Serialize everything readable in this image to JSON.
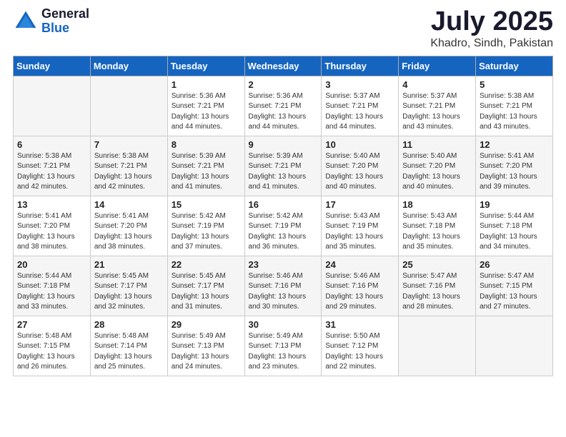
{
  "logo": {
    "general": "General",
    "blue": "Blue"
  },
  "title": "July 2025",
  "location": "Khadro, Sindh, Pakistan",
  "days_header": [
    "Sunday",
    "Monday",
    "Tuesday",
    "Wednesday",
    "Thursday",
    "Friday",
    "Saturday"
  ],
  "weeks": [
    [
      {
        "day": "",
        "info": ""
      },
      {
        "day": "",
        "info": ""
      },
      {
        "day": "1",
        "info": "Sunrise: 5:36 AM\nSunset: 7:21 PM\nDaylight: 13 hours and 44 minutes."
      },
      {
        "day": "2",
        "info": "Sunrise: 5:36 AM\nSunset: 7:21 PM\nDaylight: 13 hours and 44 minutes."
      },
      {
        "day": "3",
        "info": "Sunrise: 5:37 AM\nSunset: 7:21 PM\nDaylight: 13 hours and 44 minutes."
      },
      {
        "day": "4",
        "info": "Sunrise: 5:37 AM\nSunset: 7:21 PM\nDaylight: 13 hours and 43 minutes."
      },
      {
        "day": "5",
        "info": "Sunrise: 5:38 AM\nSunset: 7:21 PM\nDaylight: 13 hours and 43 minutes."
      }
    ],
    [
      {
        "day": "6",
        "info": "Sunrise: 5:38 AM\nSunset: 7:21 PM\nDaylight: 13 hours and 42 minutes."
      },
      {
        "day": "7",
        "info": "Sunrise: 5:38 AM\nSunset: 7:21 PM\nDaylight: 13 hours and 42 minutes."
      },
      {
        "day": "8",
        "info": "Sunrise: 5:39 AM\nSunset: 7:21 PM\nDaylight: 13 hours and 41 minutes."
      },
      {
        "day": "9",
        "info": "Sunrise: 5:39 AM\nSunset: 7:21 PM\nDaylight: 13 hours and 41 minutes."
      },
      {
        "day": "10",
        "info": "Sunrise: 5:40 AM\nSunset: 7:20 PM\nDaylight: 13 hours and 40 minutes."
      },
      {
        "day": "11",
        "info": "Sunrise: 5:40 AM\nSunset: 7:20 PM\nDaylight: 13 hours and 40 minutes."
      },
      {
        "day": "12",
        "info": "Sunrise: 5:41 AM\nSunset: 7:20 PM\nDaylight: 13 hours and 39 minutes."
      }
    ],
    [
      {
        "day": "13",
        "info": "Sunrise: 5:41 AM\nSunset: 7:20 PM\nDaylight: 13 hours and 38 minutes."
      },
      {
        "day": "14",
        "info": "Sunrise: 5:41 AM\nSunset: 7:20 PM\nDaylight: 13 hours and 38 minutes."
      },
      {
        "day": "15",
        "info": "Sunrise: 5:42 AM\nSunset: 7:19 PM\nDaylight: 13 hours and 37 minutes."
      },
      {
        "day": "16",
        "info": "Sunrise: 5:42 AM\nSunset: 7:19 PM\nDaylight: 13 hours and 36 minutes."
      },
      {
        "day": "17",
        "info": "Sunrise: 5:43 AM\nSunset: 7:19 PM\nDaylight: 13 hours and 35 minutes."
      },
      {
        "day": "18",
        "info": "Sunrise: 5:43 AM\nSunset: 7:18 PM\nDaylight: 13 hours and 35 minutes."
      },
      {
        "day": "19",
        "info": "Sunrise: 5:44 AM\nSunset: 7:18 PM\nDaylight: 13 hours and 34 minutes."
      }
    ],
    [
      {
        "day": "20",
        "info": "Sunrise: 5:44 AM\nSunset: 7:18 PM\nDaylight: 13 hours and 33 minutes."
      },
      {
        "day": "21",
        "info": "Sunrise: 5:45 AM\nSunset: 7:17 PM\nDaylight: 13 hours and 32 minutes."
      },
      {
        "day": "22",
        "info": "Sunrise: 5:45 AM\nSunset: 7:17 PM\nDaylight: 13 hours and 31 minutes."
      },
      {
        "day": "23",
        "info": "Sunrise: 5:46 AM\nSunset: 7:16 PM\nDaylight: 13 hours and 30 minutes."
      },
      {
        "day": "24",
        "info": "Sunrise: 5:46 AM\nSunset: 7:16 PM\nDaylight: 13 hours and 29 minutes."
      },
      {
        "day": "25",
        "info": "Sunrise: 5:47 AM\nSunset: 7:16 PM\nDaylight: 13 hours and 28 minutes."
      },
      {
        "day": "26",
        "info": "Sunrise: 5:47 AM\nSunset: 7:15 PM\nDaylight: 13 hours and 27 minutes."
      }
    ],
    [
      {
        "day": "27",
        "info": "Sunrise: 5:48 AM\nSunset: 7:15 PM\nDaylight: 13 hours and 26 minutes."
      },
      {
        "day": "28",
        "info": "Sunrise: 5:48 AM\nSunset: 7:14 PM\nDaylight: 13 hours and 25 minutes."
      },
      {
        "day": "29",
        "info": "Sunrise: 5:49 AM\nSunset: 7:13 PM\nDaylight: 13 hours and 24 minutes."
      },
      {
        "day": "30",
        "info": "Sunrise: 5:49 AM\nSunset: 7:13 PM\nDaylight: 13 hours and 23 minutes."
      },
      {
        "day": "31",
        "info": "Sunrise: 5:50 AM\nSunset: 7:12 PM\nDaylight: 13 hours and 22 minutes."
      },
      {
        "day": "",
        "info": ""
      },
      {
        "day": "",
        "info": ""
      }
    ]
  ]
}
